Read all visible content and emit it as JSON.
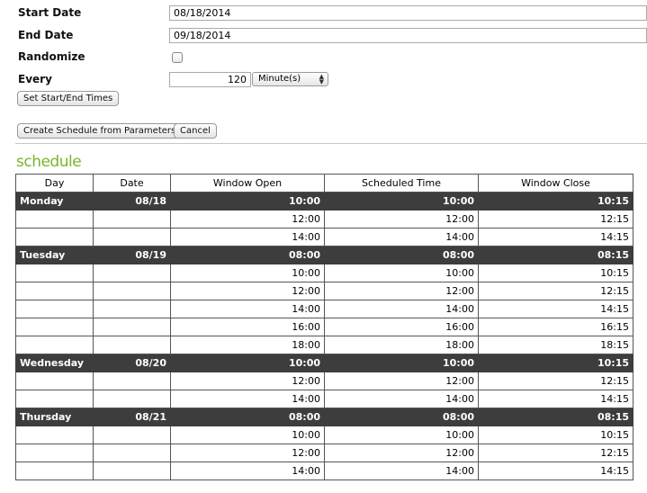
{
  "form": {
    "start_date_label": "Start Date",
    "start_date_value": "08/18/2014",
    "end_date_label": "End Date",
    "end_date_value": "09/18/2014",
    "randomize_label": "Randomize",
    "randomize_checked": false,
    "every_label": "Every",
    "every_value": "120",
    "every_unit": "Minute(s)",
    "set_times_button": "Set Start/End Times",
    "create_button": "Create Schedule from Parameters",
    "cancel_button": "Cancel"
  },
  "schedule": {
    "title": "schedule",
    "title_color": "#7ab52a",
    "day_row_color": "#3d3d3d",
    "columns": [
      "Day",
      "Date",
      "Window Open",
      "Scheduled Time",
      "Window Close"
    ],
    "rows": [
      {
        "day": "Monday",
        "date": "08/18",
        "open": "10:00",
        "scheduled": "10:00",
        "close": "10:15"
      },
      {
        "day": "",
        "date": "",
        "open": "12:00",
        "scheduled": "12:00",
        "close": "12:15"
      },
      {
        "day": "",
        "date": "",
        "open": "14:00",
        "scheduled": "14:00",
        "close": "14:15"
      },
      {
        "day": "Tuesday",
        "date": "08/19",
        "open": "08:00",
        "scheduled": "08:00",
        "close": "08:15"
      },
      {
        "day": "",
        "date": "",
        "open": "10:00",
        "scheduled": "10:00",
        "close": "10:15"
      },
      {
        "day": "",
        "date": "",
        "open": "12:00",
        "scheduled": "12:00",
        "close": "12:15"
      },
      {
        "day": "",
        "date": "",
        "open": "14:00",
        "scheduled": "14:00",
        "close": "14:15"
      },
      {
        "day": "",
        "date": "",
        "open": "16:00",
        "scheduled": "16:00",
        "close": "16:15"
      },
      {
        "day": "",
        "date": "",
        "open": "18:00",
        "scheduled": "18:00",
        "close": "18:15"
      },
      {
        "day": "Wednesday",
        "date": "08/20",
        "open": "10:00",
        "scheduled": "10:00",
        "close": "10:15"
      },
      {
        "day": "",
        "date": "",
        "open": "12:00",
        "scheduled": "12:00",
        "close": "12:15"
      },
      {
        "day": "",
        "date": "",
        "open": "14:00",
        "scheduled": "14:00",
        "close": "14:15"
      },
      {
        "day": "Thursday",
        "date": "08/21",
        "open": "08:00",
        "scheduled": "08:00",
        "close": "08:15"
      },
      {
        "day": "",
        "date": "",
        "open": "10:00",
        "scheduled": "10:00",
        "close": "10:15"
      },
      {
        "day": "",
        "date": "",
        "open": "12:00",
        "scheduled": "12:00",
        "close": "12:15"
      },
      {
        "day": "",
        "date": "",
        "open": "14:00",
        "scheduled": "14:00",
        "close": "14:15"
      }
    ]
  }
}
